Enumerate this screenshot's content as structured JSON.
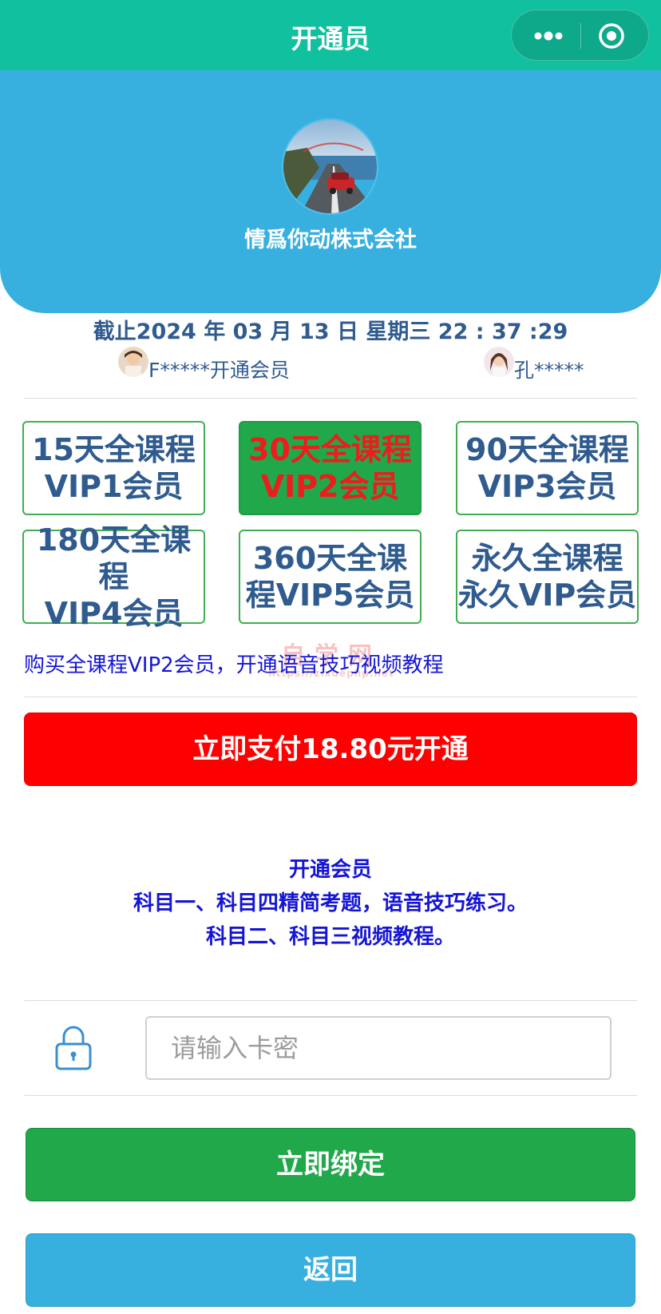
{
  "nav": {
    "title": "开通员",
    "more_icon": "more-dots-icon",
    "close_icon": "target-circle-icon"
  },
  "profile": {
    "name": "情爲你动株式会社"
  },
  "date_line": "截止2024 年 03 月 13 日 星期三 22 : 37 :29",
  "ticker": [
    {
      "text": "F*****开通会员"
    },
    {
      "text": "孔*****"
    }
  ],
  "plans": [
    {
      "line1": "15天全课程",
      "line2": "VIP1会员",
      "selected": false
    },
    {
      "line1": "30天全课程",
      "line2": "VIP2会员",
      "selected": true
    },
    {
      "line1": "90天全课程",
      "line2": "VIP3会员",
      "selected": false
    },
    {
      "line1": "180天全课程",
      "line2": "VIP4会员",
      "selected": false
    },
    {
      "line1": "360天全课",
      "line2": "程VIP5会员",
      "selected": false
    },
    {
      "line1": "永久全课程",
      "line2": "永久VIP会员",
      "selected": false
    }
  ],
  "buy_description": "购买全课程VIP2会员，开通语音技巧视频教程",
  "watermark": {
    "main": "自学网",
    "sub": "https://zixuephp.net"
  },
  "pay_button": "立即支付18.80元开通",
  "info": {
    "line1": "开通会员",
    "line2": "科目一、科目四精简考题，语音技巧练习。",
    "line3": "科目二、科目三视频教程。"
  },
  "card": {
    "placeholder": "请输入卡密",
    "value": "",
    "icon": "lock-icon"
  },
  "bind_button": "立即绑定",
  "back_button": "返回",
  "colors": {
    "nav": "#11c09e",
    "hero": "#37b0df",
    "pay": "#ff0000",
    "bind": "#21a84a",
    "back": "#37b0df",
    "text_blue": "#1515d6",
    "plan_text": "#2f5b8f"
  }
}
